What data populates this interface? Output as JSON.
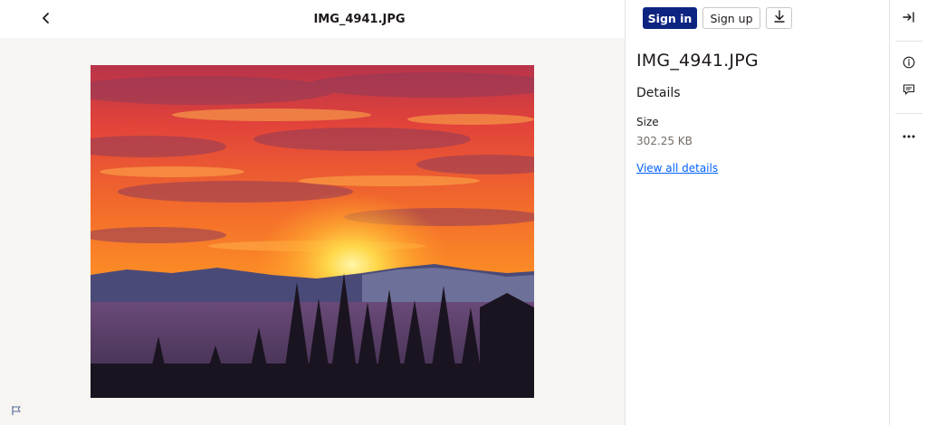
{
  "header": {
    "file_name": "IMG_4941.JPG"
  },
  "actions": {
    "sign_in_label": "Sign in",
    "sign_up_label": "Sign up"
  },
  "details": {
    "title": "IMG_4941.JPG",
    "section_heading": "Details",
    "size_label": "Size",
    "size_value": "302.25 KB",
    "view_all_link": "View all details"
  },
  "icons": {
    "back": "chevron-left-icon",
    "download": "download-icon",
    "collapse_panel": "collapse-panel-icon",
    "info": "info-icon",
    "comment": "comment-icon",
    "more": "more-icon",
    "flag": "flag-icon"
  },
  "colors": {
    "primary_button": "#0d2481",
    "link": "#0061fe",
    "viewer_background": "#f7f5f2"
  }
}
